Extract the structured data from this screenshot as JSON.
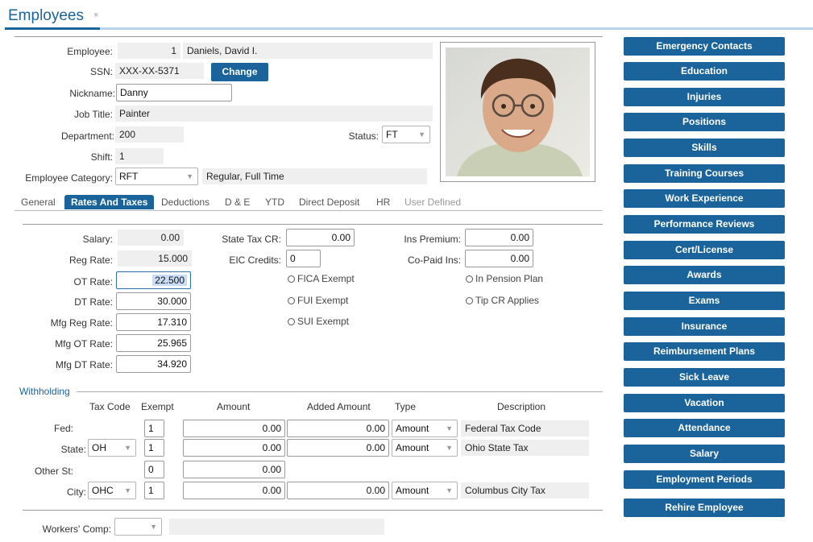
{
  "window": {
    "tab_title": "Employees",
    "tab_close": "×"
  },
  "employee": {
    "label": "Employee:",
    "number": "1",
    "name": "Daniels, David I.",
    "ssn_label": "SSN:",
    "ssn": "XXX-XX-5371",
    "change_label": "Change",
    "nickname_label": "Nickname:",
    "nickname": "Danny",
    "job_title_label": "Job Title:",
    "job_title": "Painter",
    "department_label": "Department:",
    "department": "200",
    "status_label": "Status:",
    "status": "FT",
    "shift_label": "Shift:",
    "shift": "1",
    "category_label": "Employee Category:",
    "category": "RFT",
    "category_desc": "Regular, Full Time"
  },
  "tabs": [
    {
      "label": "General",
      "state": "normal"
    },
    {
      "label": "Rates And Taxes",
      "state": "active"
    },
    {
      "label": "Deductions",
      "state": "normal"
    },
    {
      "label": "D & E",
      "state": "normal"
    },
    {
      "label": "YTD",
      "state": "normal"
    },
    {
      "label": "Direct Deposit",
      "state": "normal"
    },
    {
      "label": "HR",
      "state": "normal"
    },
    {
      "label": "User Defined",
      "state": "muted"
    }
  ],
  "rates": {
    "salary_label": "Salary:",
    "salary": "0.00",
    "reg_rate_label": "Reg Rate:",
    "reg_rate": "15.000",
    "ot_rate_label": "OT Rate:",
    "ot_rate": "22.500",
    "dt_rate_label": "DT Rate:",
    "dt_rate": "30.000",
    "mfg_reg_label": "Mfg Reg Rate:",
    "mfg_reg": "17.310",
    "mfg_ot_label": "Mfg OT Rate:",
    "mfg_ot": "25.965",
    "mfg_dt_label": "Mfg DT Rate:",
    "mfg_dt": "34.920",
    "state_tax_cr_label": "State Tax CR:",
    "state_tax_cr": "0.00",
    "eic_label": "EIC Credits:",
    "eic": "0",
    "fica_label": "FICA Exempt",
    "fui_label": "FUI Exempt",
    "sui_label": "SUI Exempt",
    "ins_premium_label": "Ins Premium:",
    "ins_premium": "0.00",
    "copaid_label": "Co-Paid Ins:",
    "copaid": "0.00",
    "pension_label": "In Pension Plan",
    "tipcr_label": "Tip CR Applies"
  },
  "withholding": {
    "title": "Withholding",
    "headers": {
      "tax_code": "Tax Code",
      "exempt": "Exempt",
      "amount": "Amount",
      "added": "Added Amount",
      "type": "Type",
      "description": "Description"
    },
    "fed": {
      "label": "Fed:",
      "exempt": "1",
      "amount": "0.00",
      "added": "0.00",
      "type": "Amount",
      "description": "Federal Tax Code"
    },
    "state": {
      "label": "State:",
      "code": "OH",
      "exempt": "1",
      "amount": "0.00",
      "added": "0.00",
      "type": "Amount",
      "description": "Ohio State Tax"
    },
    "other": {
      "label": "Other St:",
      "exempt": "0",
      "amount": "0.00"
    },
    "city": {
      "label": "City:",
      "code": "OHC",
      "exempt": "1",
      "amount": "0.00",
      "added": "0.00",
      "type": "Amount",
      "description": "Columbus City Tax"
    }
  },
  "workers_comp": {
    "label": "Workers' Comp:"
  },
  "sidebar": {
    "buttons": [
      "Emergency Contacts",
      "Education",
      "Injuries",
      "Positions",
      "Skills",
      "Training Courses",
      "Work Experience",
      "Performance Reviews",
      "Cert/License",
      "Awards",
      "Exams",
      "Insurance",
      "Reimbursement Plans",
      "Sick Leave",
      "Vacation",
      "Attendance",
      "Salary",
      "Employment Periods",
      "Rehire Employee"
    ]
  },
  "colors": {
    "accent": "#1a639b",
    "readonly_bg": "#efefef",
    "tab_underline": "#b9d3ee"
  }
}
